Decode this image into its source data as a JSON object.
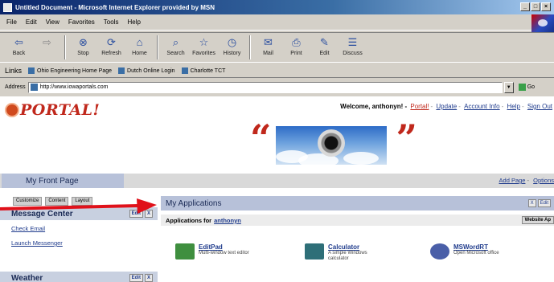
{
  "window": {
    "title": "Untitled Document - Microsoft Internet Explorer provided by MSN"
  },
  "menu": [
    "File",
    "Edit",
    "View",
    "Favorites",
    "Tools",
    "Help"
  ],
  "toolbar": [
    {
      "label": "Back",
      "icon": "back-arrow-icon",
      "glyph": "⇦",
      "enabled": true
    },
    {
      "label": "",
      "icon": "forward-arrow-icon",
      "glyph": "⇨",
      "enabled": false
    },
    {
      "label": "Stop",
      "icon": "stop-icon",
      "glyph": "⊗",
      "enabled": true
    },
    {
      "label": "Refresh",
      "icon": "refresh-icon",
      "glyph": "⟳",
      "enabled": true
    },
    {
      "label": "Home",
      "icon": "home-icon",
      "glyph": "⌂",
      "enabled": true
    },
    {
      "label": "Search",
      "icon": "search-icon",
      "glyph": "⌕",
      "enabled": true
    },
    {
      "label": "Favorites",
      "icon": "favorites-icon",
      "glyph": "☆",
      "enabled": true
    },
    {
      "label": "History",
      "icon": "history-icon",
      "glyph": "◷",
      "enabled": true
    },
    {
      "label": "Mail",
      "icon": "mail-icon",
      "glyph": "✉",
      "enabled": true
    },
    {
      "label": "Print",
      "icon": "print-icon",
      "glyph": "⎙",
      "enabled": true
    },
    {
      "label": "Edit",
      "icon": "edit-icon",
      "glyph": "✎",
      "enabled": true
    },
    {
      "label": "Discuss",
      "icon": "discuss-icon",
      "glyph": "☰",
      "enabled": true
    }
  ],
  "links_bar": {
    "label": "Links",
    "items": [
      "Ohio Engineering Home Page",
      "Dutch Online Login",
      "Charlotte TCT"
    ]
  },
  "address": {
    "label": "Address",
    "value": "http://www.iowaportals.com",
    "go_label": "Go"
  },
  "portal": {
    "logo_text": "PORTAL!",
    "welcome": "Welcome, anthonyn! -",
    "brand_link": "Portal!",
    "nav": [
      "Update",
      "Account Info",
      "Help",
      "Sign Out"
    ],
    "tab_active": "My Front Page",
    "tab_links": [
      "Add Page",
      "Options"
    ],
    "left_controls": [
      "Customize",
      "Content",
      "Layout"
    ],
    "message_center": {
      "title": "Message Center",
      "edit": "Edit",
      "close": "X",
      "links": [
        "Check Email",
        "Launch Messenger"
      ]
    },
    "weather": {
      "title": "Weather",
      "edit": "Edit",
      "close": "X"
    },
    "applications": {
      "title": "My Applications",
      "edit": "Edit",
      "close": "X",
      "subtitle_prefix": "Applications for",
      "user": "anthonyn",
      "website_btn": "Website Ap",
      "items": [
        {
          "name": "EditPad",
          "desc": "Multi-window text editor",
          "color": "#3f8f3f"
        },
        {
          "name": "Calculator",
          "desc": "A simple Windows calculator",
          "color": "#2e6f78"
        },
        {
          "name": "MSWordRT",
          "desc": "Open Microsoft office",
          "color": "#4a5fa8"
        }
      ]
    }
  },
  "colors": {
    "arrow": "#e0111a",
    "portal_red": "#c0281c",
    "header_blue": "#b7c1d9"
  }
}
